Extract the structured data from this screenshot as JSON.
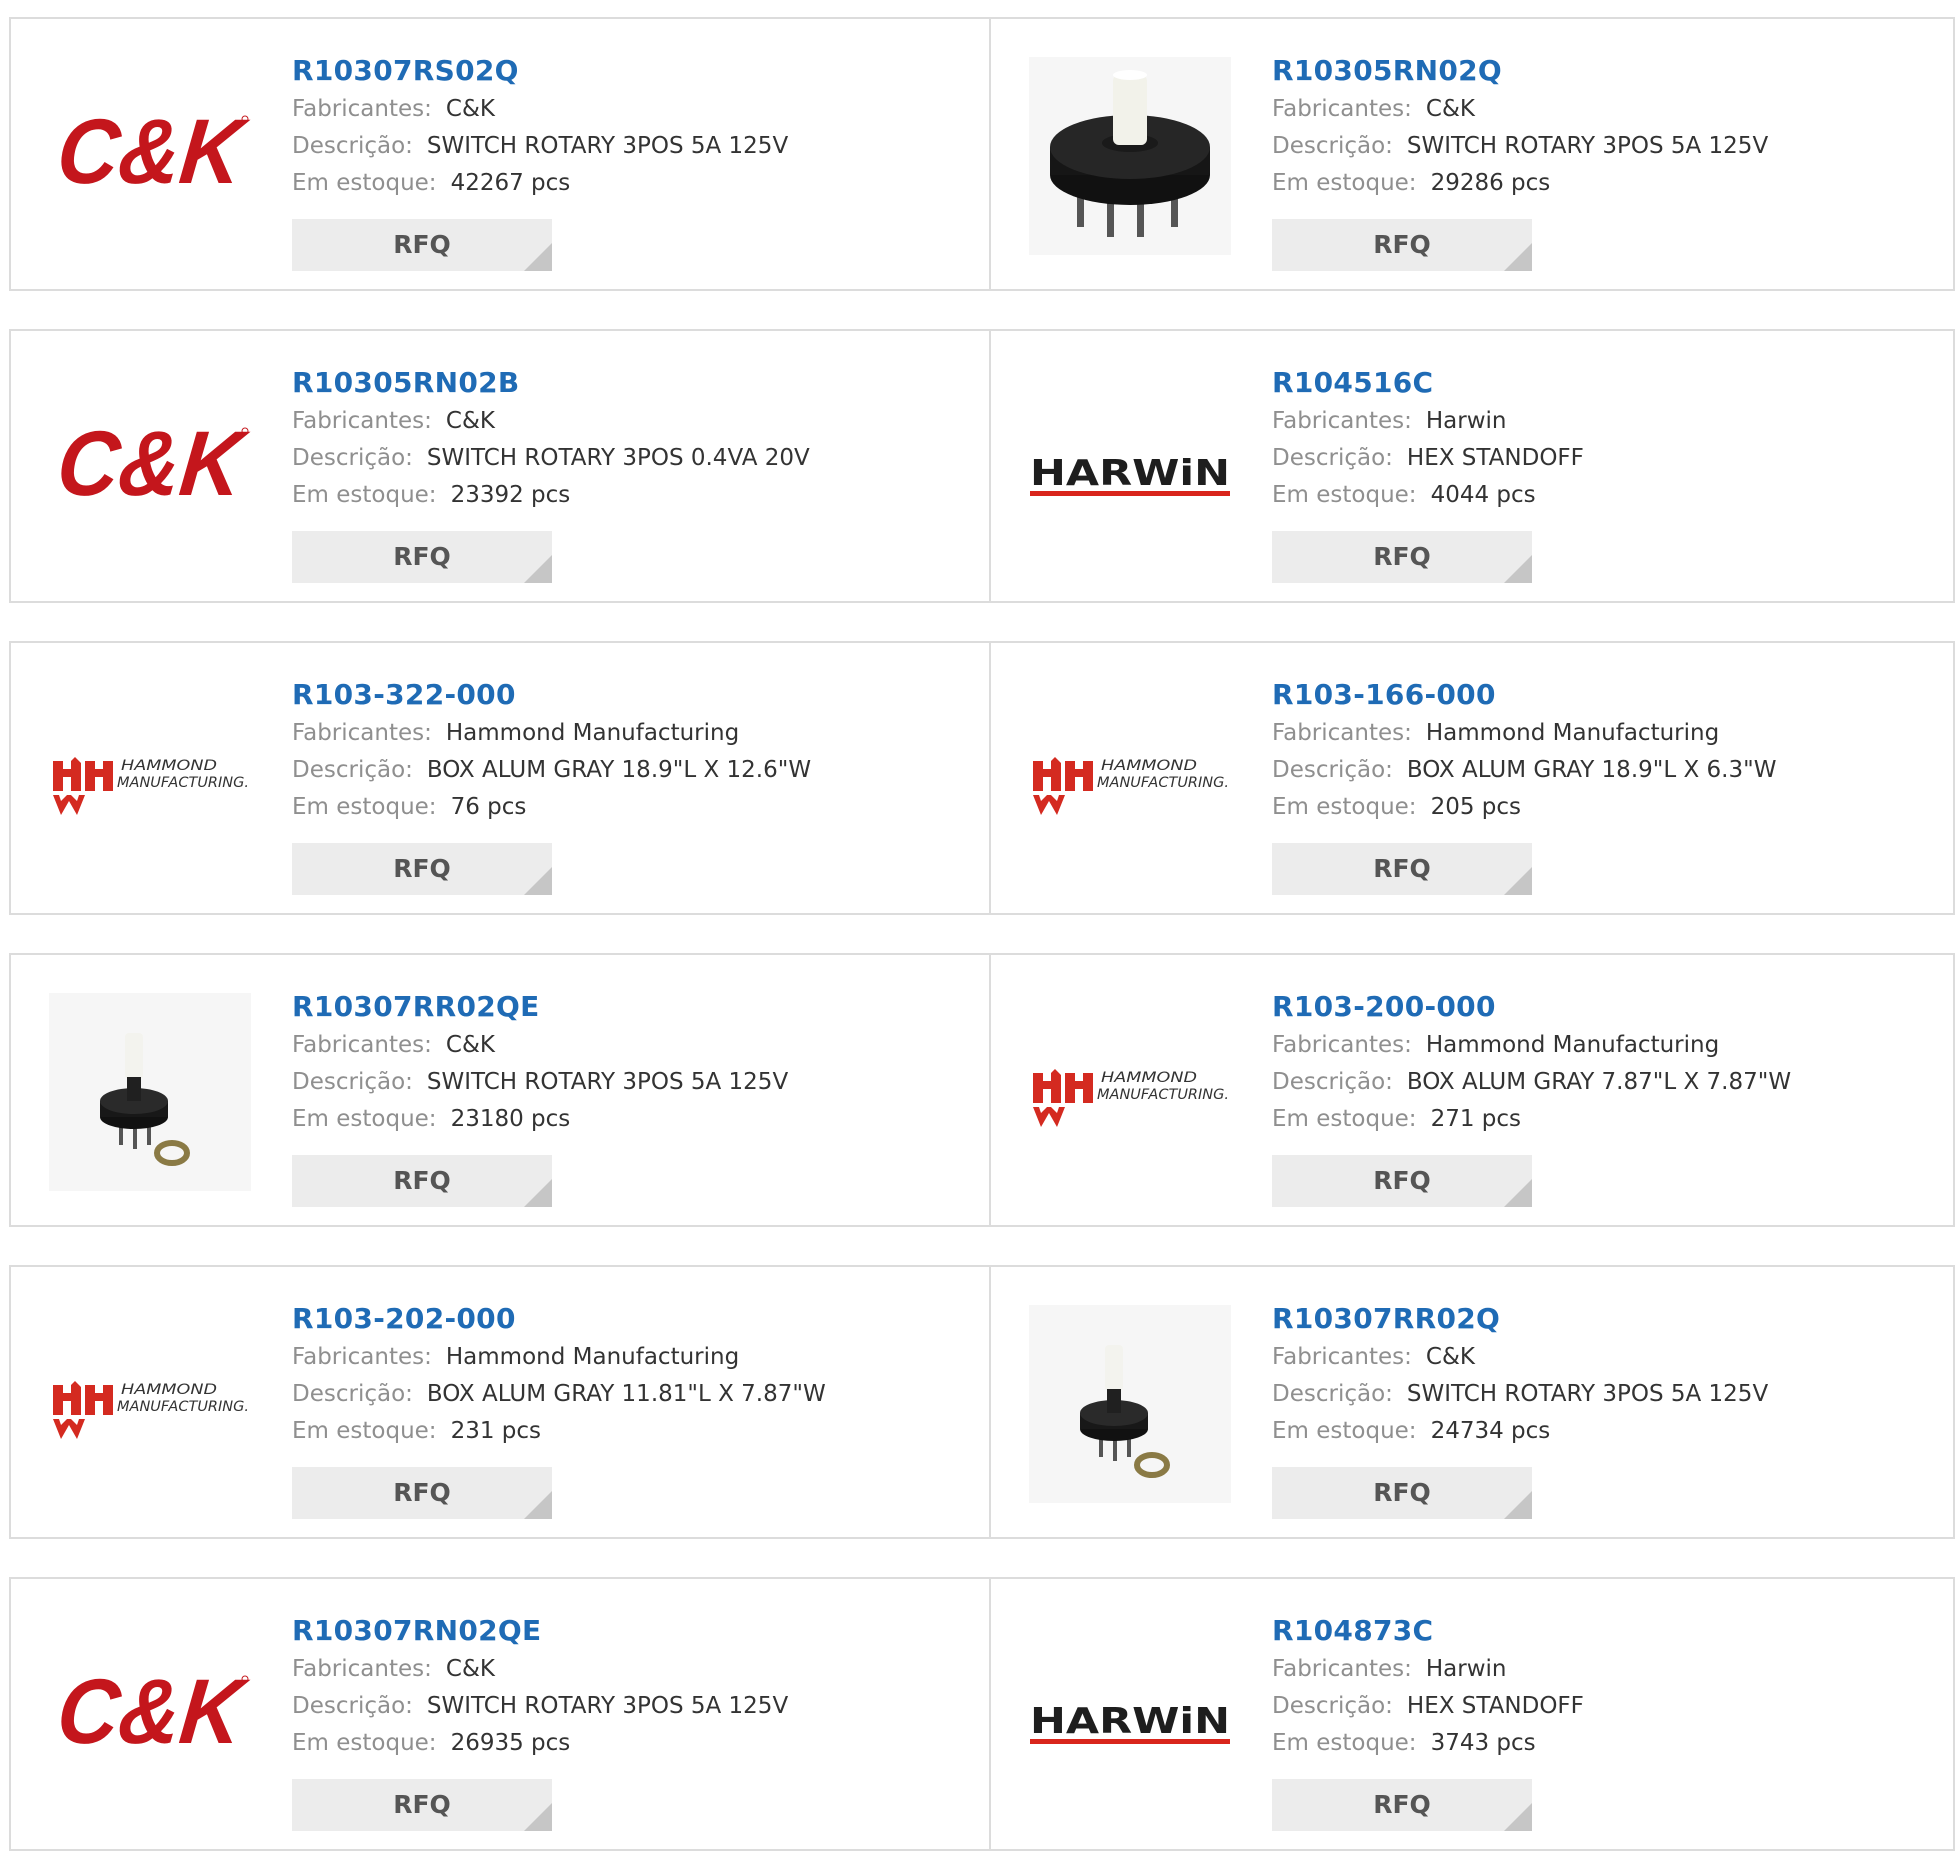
{
  "labels": {
    "manufacturer": "Fabricantes:",
    "description": "Descrição:",
    "stock": "Em estoque:"
  },
  "rfq_label": "RFQ",
  "brand_logos": {
    "ck": "C&K",
    "harwin": "HARWiN",
    "hammond_line1": "HAMMOND",
    "hammond_line2": "MANUFACTURING."
  },
  "colors": {
    "part_link": "#1f6bb5",
    "ck_red": "#c4161c",
    "harwin_red": "#d9251c",
    "hammond_red": "#d42a20"
  },
  "products": [
    {
      "part": "R10307RS02Q",
      "manufacturer": "C&K",
      "description": "SWITCH ROTARY 3POS 5A 125V",
      "stock": "42267 pcs",
      "image": "ck-logo"
    },
    {
      "part": "R10305RN02Q",
      "manufacturer": "C&K",
      "description": "SWITCH ROTARY 3POS 5A 125V",
      "stock": "29286 pcs",
      "image": "rotary-switch-photo"
    },
    {
      "part": "R10305RN02B",
      "manufacturer": "C&K",
      "description": "SWITCH ROTARY 3POS 0.4VA 20V",
      "stock": "23392 pcs",
      "image": "ck-logo"
    },
    {
      "part": "R104516C",
      "manufacturer": "Harwin",
      "description": "HEX STANDOFF",
      "stock": "4044 pcs",
      "image": "harwin-logo"
    },
    {
      "part": "R103-322-000",
      "manufacturer": "Hammond Manufacturing",
      "description": "BOX ALUM GRAY 18.9\"L X 12.6\"W",
      "stock": "76 pcs",
      "image": "hammond-logo"
    },
    {
      "part": "R103-166-000",
      "manufacturer": "Hammond Manufacturing",
      "description": "BOX ALUM GRAY 18.9\"L X 6.3\"W",
      "stock": "205 pcs",
      "image": "hammond-logo"
    },
    {
      "part": "R10307RR02QE",
      "manufacturer": "C&K",
      "description": "SWITCH ROTARY 3POS 5A 125V",
      "stock": "23180 pcs",
      "image": "rotary-switch-nut-photo"
    },
    {
      "part": "R103-200-000",
      "manufacturer": "Hammond Manufacturing",
      "description": "BOX ALUM GRAY 7.87\"L X 7.87\"W",
      "stock": "271 pcs",
      "image": "hammond-logo"
    },
    {
      "part": "R103-202-000",
      "manufacturer": "Hammond Manufacturing",
      "description": "BOX ALUM GRAY 11.81\"L X 7.87\"W",
      "stock": "231 pcs",
      "image": "hammond-logo"
    },
    {
      "part": "R10307RR02Q",
      "manufacturer": "C&K",
      "description": "SWITCH ROTARY 3POS 5A 125V",
      "stock": "24734 pcs",
      "image": "rotary-switch-nut-photo"
    },
    {
      "part": "R10307RN02QE",
      "manufacturer": "C&K",
      "description": "SWITCH ROTARY 3POS 5A 125V",
      "stock": "26935 pcs",
      "image": "ck-logo"
    },
    {
      "part": "R104873C",
      "manufacturer": "Harwin",
      "description": "HEX STANDOFF",
      "stock": "3743 pcs",
      "image": "harwin-logo"
    }
  ]
}
